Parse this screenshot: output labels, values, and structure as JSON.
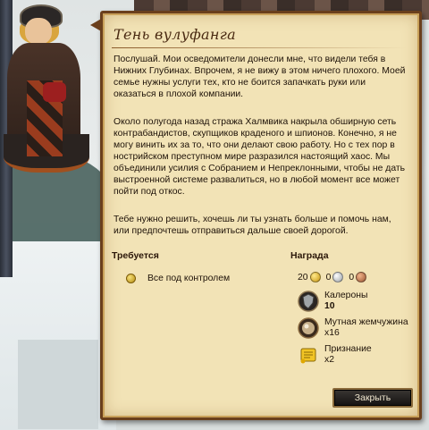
{
  "dialog": {
    "title": "Тень вулуфанга",
    "paragraphs": [
      "Послушай. Мои осведомители донесли мне, что видели тебя в Нижних Глубинах. Впрочем, я не вижу в этом ничего плохого. Моей семье нужны услуги тех, кто не боится запачкать руки или оказаться в плохой компании.",
      "Около полугода назад стража Халмвика накрыла обширную сеть контрабандистов, скупщиков краденого и шпионов. Конечно, я не могу винить их за то, что они делают свою работу. Но с тех пор в нострийском преступном мире разразился настоящий хаос. Мы объединили усилия с Собранием и Непреклонными, чтобы не дать выстроенной системе развалиться, но в любой момент все может пойти под откос.",
      "Тебе нужно решить, хочешь ли ты узнать больше и помочь нам, или предпочтешь отправиться дальше своей дорогой."
    ],
    "requirements": {
      "heading": "Требуется",
      "items": [
        {
          "label": "Все под контролем",
          "icon": "objective-dot-icon"
        }
      ]
    },
    "rewards": {
      "heading": "Награда",
      "coins": {
        "gold": "20",
        "silver": "0",
        "copper": "0"
      },
      "items": [
        {
          "name": "Калероны",
          "qty": "10",
          "icon": "shield-icon"
        },
        {
          "name": "Мутная жемчужина",
          "qty": "x16",
          "icon": "pearl-icon"
        },
        {
          "name": "Признание",
          "qty": "x2",
          "icon": "scroll-icon"
        }
      ]
    },
    "claim_label": "Закрыть"
  },
  "colors": {
    "parchment": "#f2e3b6",
    "frame": "#6a3f1c",
    "button": "#1f1c1a"
  }
}
